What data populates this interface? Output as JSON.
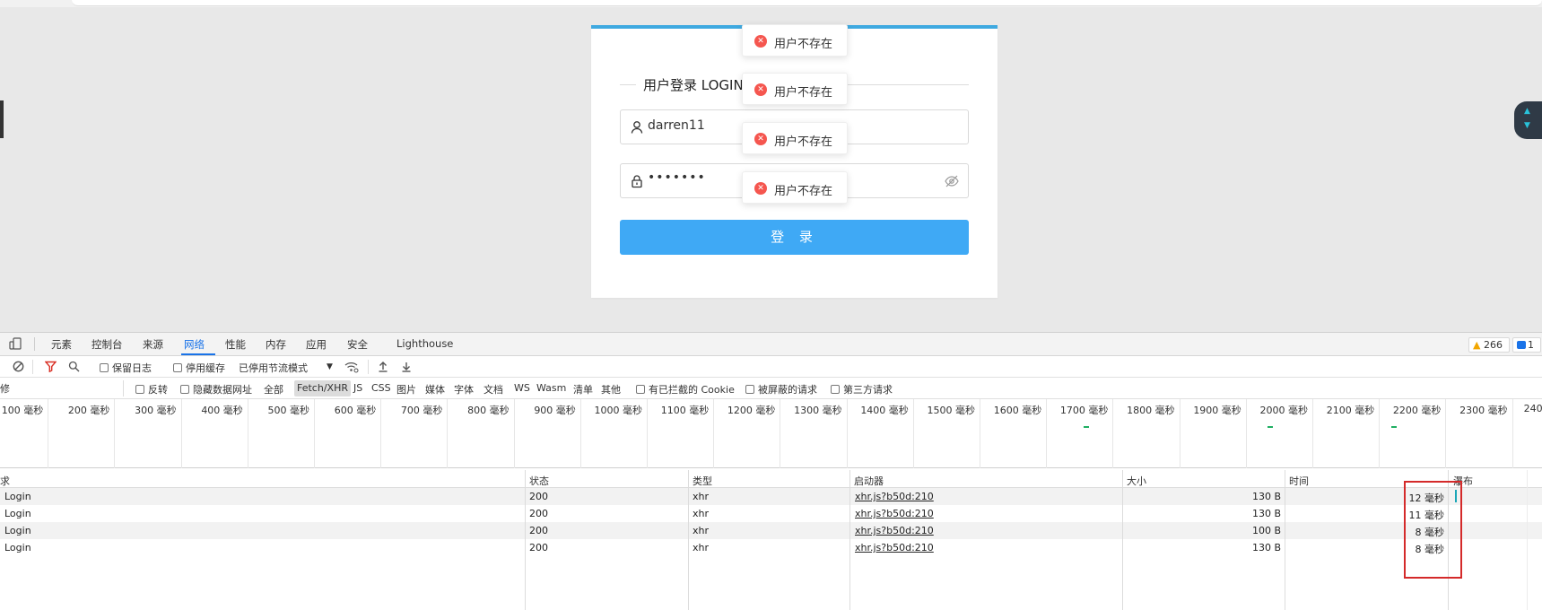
{
  "login": {
    "title": "用户登录 LOGIN",
    "username": "darren11",
    "password": "•••••••",
    "submit_label": "登 录"
  },
  "toasts": [
    {
      "message": "用户不存在"
    },
    {
      "message": "用户不存在"
    },
    {
      "message": "用户不存在"
    },
    {
      "message": "用户不存在"
    }
  ],
  "devtools": {
    "tabs": [
      "元素",
      "控制台",
      "来源",
      "网络",
      "性能",
      "内存",
      "应用",
      "安全",
      "Lighthouse"
    ],
    "active_tab": "网络",
    "warnings_count": "266",
    "messages_count": "1",
    "toolbar": {
      "preserve_log": "保留日志",
      "disable_cache": "停用缓存",
      "throttle": "已停用节流模式"
    },
    "filter": {
      "input_fragment": "修",
      "invert": "反转",
      "hide_data_urls": "隐藏数据网址",
      "types": [
        "全部",
        "Fetch/XHR",
        "JS",
        "CSS",
        "图片",
        "媒体",
        "字体",
        "文档",
        "WS",
        "Wasm",
        "清单",
        "其他"
      ],
      "selected_type": "Fetch/XHR",
      "blocked_cookies": "有已拦截的 Cookie",
      "blocked_requests": "被屏蔽的请求",
      "third_party": "第三方请求"
    },
    "timeline_ticks": [
      "100 毫秒",
      "200 毫秒",
      "300 毫秒",
      "400 毫秒",
      "500 毫秒",
      "600 毫秒",
      "700 毫秒",
      "800 毫秒",
      "900 毫秒",
      "1000 毫秒",
      "1100 毫秒",
      "1200 毫秒",
      "1300 毫秒",
      "1400 毫秒",
      "1500 毫秒",
      "1600 毫秒",
      "1700 毫秒",
      "1800 毫秒",
      "1900 毫秒",
      "2000 毫秒",
      "2100 毫秒",
      "2200 毫秒",
      "2300 毫秒",
      "240"
    ],
    "columns": {
      "name": "求",
      "status": "状态",
      "type": "类型",
      "initiator": "启动器",
      "size": "大小",
      "time": "时间",
      "waterfall": "瀑布"
    },
    "requests": [
      {
        "name": "Login",
        "status": "200",
        "type": "xhr",
        "initiator": "xhr.js?b50d:210",
        "size": "130 B",
        "time": "12 毫秒"
      },
      {
        "name": "Login",
        "status": "200",
        "type": "xhr",
        "initiator": "xhr.js?b50d:210",
        "size": "130 B",
        "time": "11 毫秒"
      },
      {
        "name": "Login",
        "status": "200",
        "type": "xhr",
        "initiator": "xhr.js?b50d:210",
        "size": "100 B",
        "time": "8 毫秒"
      },
      {
        "name": "Login",
        "status": "200",
        "type": "xhr",
        "initiator": "xhr.js?b50d:210",
        "size": "130 B",
        "time": "8 毫秒"
      }
    ]
  },
  "colors": {
    "accent_blue": "#3fa9f5",
    "card_top_border": "#3fa9e0",
    "error_red": "#f5564f",
    "devtools_active": "#1a73e8",
    "annotation_red": "#d42a2a"
  }
}
